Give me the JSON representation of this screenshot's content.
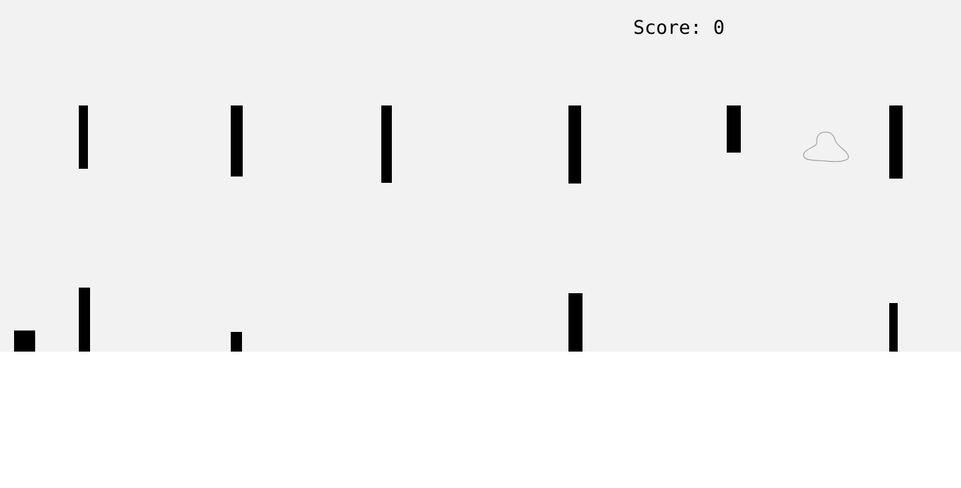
{
  "hud": {
    "score_label": "Score:",
    "score_value": "0"
  },
  "player": {
    "icon": "cloud-blob-icon",
    "stroke_color": "#a0a0a0"
  },
  "colors": {
    "background": "#f2f2f2",
    "obstacle": "#000000",
    "page": "#ffffff"
  }
}
